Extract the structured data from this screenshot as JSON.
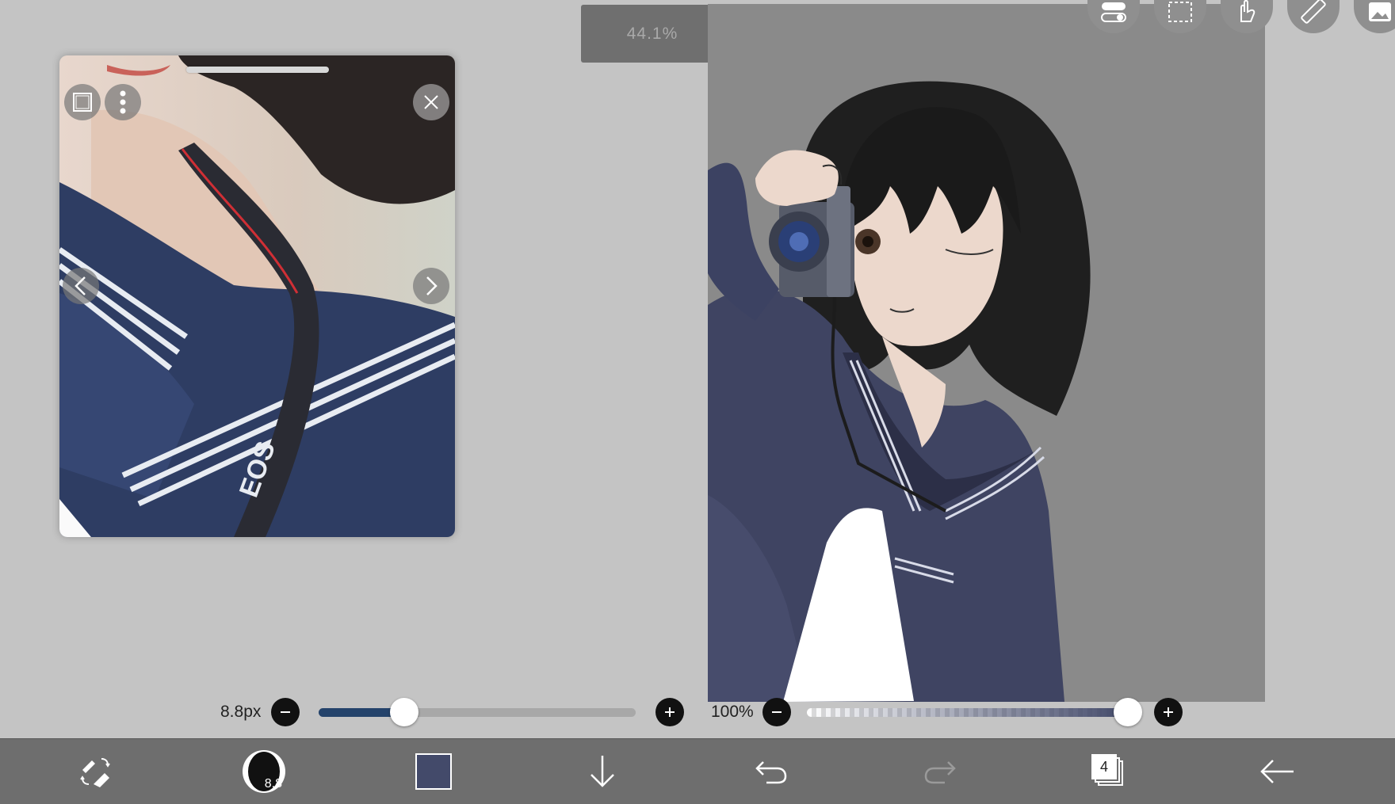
{
  "zoom": {
    "value": "44.1%"
  },
  "top_tools": [
    {
      "name": "layer-toggle-icon"
    },
    {
      "name": "selection-icon"
    },
    {
      "name": "hand-icon"
    },
    {
      "name": "ruler-icon"
    },
    {
      "name": "image-icon"
    }
  ],
  "reference_window": {
    "title": "",
    "buttons": [
      "crop-icon",
      "more-icon",
      "close-icon",
      "prev-icon",
      "next-icon"
    ],
    "camera_strap_text": "EOS"
  },
  "brush_size": {
    "label": "8.8px",
    "fraction": 0.27
  },
  "opacity": {
    "label": "100%",
    "fraction": 1.0
  },
  "bottom_bar": {
    "brush_badge": "8.8",
    "current_color": "#434a6a",
    "layers_count": "4"
  },
  "colors": {
    "background": "#c4c4c4",
    "canvas_bg": "#8a8a8a",
    "slider_fill": "#24436b",
    "toolbar": "#6e6e6e"
  }
}
